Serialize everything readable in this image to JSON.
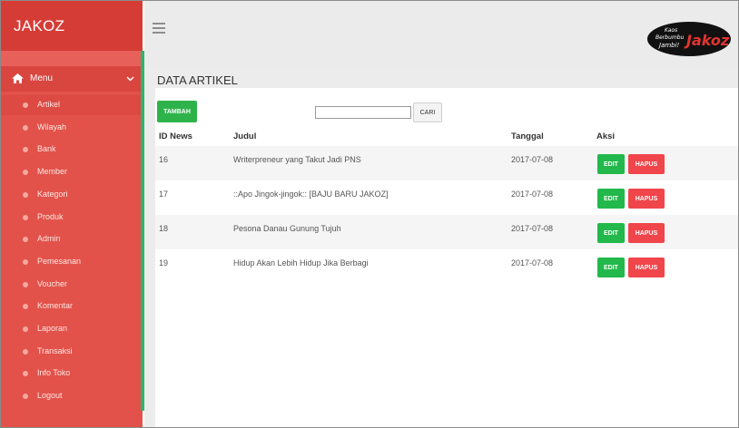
{
  "app": {
    "brand": "JAKOZ"
  },
  "sidebar": {
    "menu_label": "Menu",
    "items": [
      {
        "label": "Artikel",
        "active": true
      },
      {
        "label": "Wilayah"
      },
      {
        "label": "Bank"
      },
      {
        "label": "Member"
      },
      {
        "label": "Kategori"
      },
      {
        "label": "Produk"
      },
      {
        "label": "Admin"
      },
      {
        "label": "Pemesanan"
      },
      {
        "label": "Voucher"
      },
      {
        "label": "Komentar"
      },
      {
        "label": "Laporan"
      },
      {
        "label": "Transaksi"
      },
      {
        "label": "Info Toko"
      },
      {
        "label": "Logout"
      }
    ]
  },
  "topbar": {
    "logo_text": {
      "line1": "Kaos",
      "line2": "Berbumbu",
      "line3": "Jambi!",
      "mark": "Jakoz"
    }
  },
  "page": {
    "title": "DATA ARTIKEL",
    "add_button": "TAMBAH",
    "search_button": "CARI",
    "search_value": "",
    "columns": [
      "ID News",
      "Judul",
      "Tanggal",
      "Aksi"
    ],
    "rows": [
      {
        "id": "16",
        "judul": "Writerpreneur yang Takut Jadi PNS",
        "tanggal": "2017-07-08",
        "edit": "EDIT",
        "hapus": "HAPUS"
      },
      {
        "id": "17",
        "judul": "::Apo Jingok-jingok:: [BAJU BARU JAKOZ]",
        "tanggal": "2017-07-08",
        "edit": "EDIT",
        "hapus": "HAPUS"
      },
      {
        "id": "18",
        "judul": "Pesona Danau Gunung Tujuh",
        "tanggal": "2017-07-08",
        "edit": "EDIT",
        "hapus": "HAPUS"
      },
      {
        "id": "19",
        "judul": "Hidup Akan Lebih Hidup Jika Berbagi",
        "tanggal": "2017-07-08",
        "edit": "EDIT",
        "hapus": "HAPUS"
      }
    ]
  },
  "colors": {
    "sidebar": "#e2524a",
    "brand_bar": "#d63c36",
    "accent_green": "#2eb34a",
    "danger_red": "#f0454a"
  }
}
